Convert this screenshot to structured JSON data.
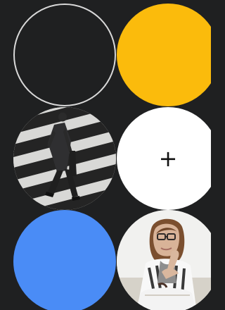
{
  "tiles": [
    {
      "id": "outline-circle",
      "kind": "outline",
      "color": "#d9d9d9"
    },
    {
      "id": "yellow-circle",
      "kind": "solid",
      "color": "#fbbb0c"
    },
    {
      "id": "crosswalk-photo",
      "kind": "photo"
    },
    {
      "id": "add-circle",
      "kind": "action",
      "icon": "plus-icon",
      "label": "+"
    },
    {
      "id": "blue-circle",
      "kind": "solid",
      "color": "#4a8cf6"
    },
    {
      "id": "woman-photo",
      "kind": "photo"
    }
  ],
  "colors": {
    "background": "#1f2021",
    "yellow": "#fbbb0c",
    "blue": "#4a8cf6",
    "white": "#ffffff",
    "outline": "#d9d9d9"
  }
}
